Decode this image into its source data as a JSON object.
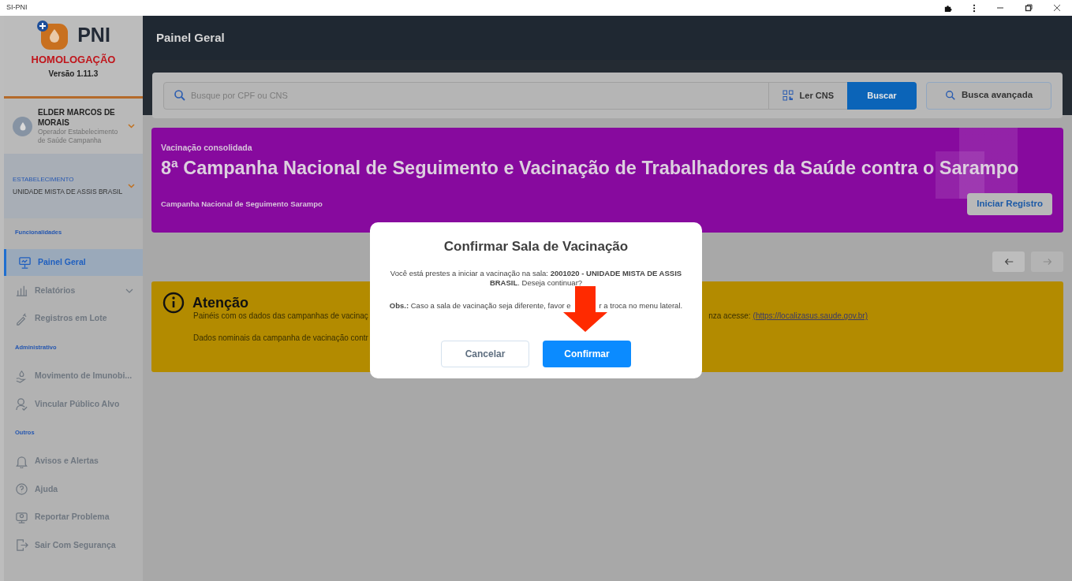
{
  "window": {
    "title": "SI-PNI"
  },
  "sidebar": {
    "logo_text": "PNI",
    "environment": "HOMOLOGAÇÃO",
    "version": "Versão 1.11.3",
    "user": {
      "name": "ELDER MARCOS DE MORAIS",
      "role": "Operador Estabelecimento de Saúde Campanha"
    },
    "establishment": {
      "label": "ESTABELECIMENTO",
      "name": "UNIDADE MISTA DE ASSIS BRASIL"
    },
    "sections": [
      {
        "title": "Funcionalidades",
        "items": [
          {
            "label": "Painel Geral",
            "selected": true,
            "kind": "link"
          },
          {
            "label": "Relatórios",
            "selected": false,
            "kind": "group"
          },
          {
            "label": "Registros em Lote",
            "selected": false,
            "kind": "link"
          }
        ]
      },
      {
        "title": "Administrativo",
        "items": [
          {
            "label": "Movimento de Imunobi...",
            "selected": false,
            "kind": "link"
          },
          {
            "label": "Vincular Público Alvo",
            "selected": false,
            "kind": "link"
          }
        ]
      },
      {
        "title": "Outros",
        "items": [
          {
            "label": "Avisos e Alertas",
            "selected": false,
            "kind": "link"
          },
          {
            "label": "Ajuda",
            "selected": false,
            "kind": "link"
          },
          {
            "label": "Reportar Problema",
            "selected": false,
            "kind": "link"
          },
          {
            "label": "Sair Com Segurança",
            "selected": false,
            "kind": "link"
          }
        ]
      }
    ]
  },
  "header": {
    "title": "Painel Geral"
  },
  "search": {
    "placeholder": "Busque por CPF ou CNS",
    "read_button": "Ler CNS",
    "search_button": "Buscar",
    "advanced_button": "Busca avançada"
  },
  "banner": {
    "eyebrow": "Vacinação consolidada",
    "title": "8ª Campanha Nacional de Seguimento e Vacinação de Trabalhadores da Saúde contra o Sarampo",
    "subtitle": "Campanha Nacional de Seguimento Sarampo",
    "button": "Iniciar Registro"
  },
  "carousel": {
    "prev_disabled": false,
    "next_disabled": true
  },
  "attention": {
    "title": "Atenção",
    "line_1_start": "Painéis com os dados das campanhas de vacinaç",
    "line_1_end": "nza acesse:",
    "link": "(https://localizasus.saude.gov.br)",
    "line_2_start": "Dados nominais da campanha de vacinação contr"
  },
  "modal": {
    "title": "Confirmar Sala de Vacinação",
    "message": "Você está prestes a iniciar a vacinação na sala: **2001020 - UNIDADE MISTA DE ASSIS BRASIL**. Deseja continuar?",
    "note_start": "**Obs.:** Caso a sala de vacinação seja diferente, favor e",
    "note_end": "r a troca no menu lateral.",
    "cancel": "Cancelar",
    "confirm": "Confirmar"
  }
}
